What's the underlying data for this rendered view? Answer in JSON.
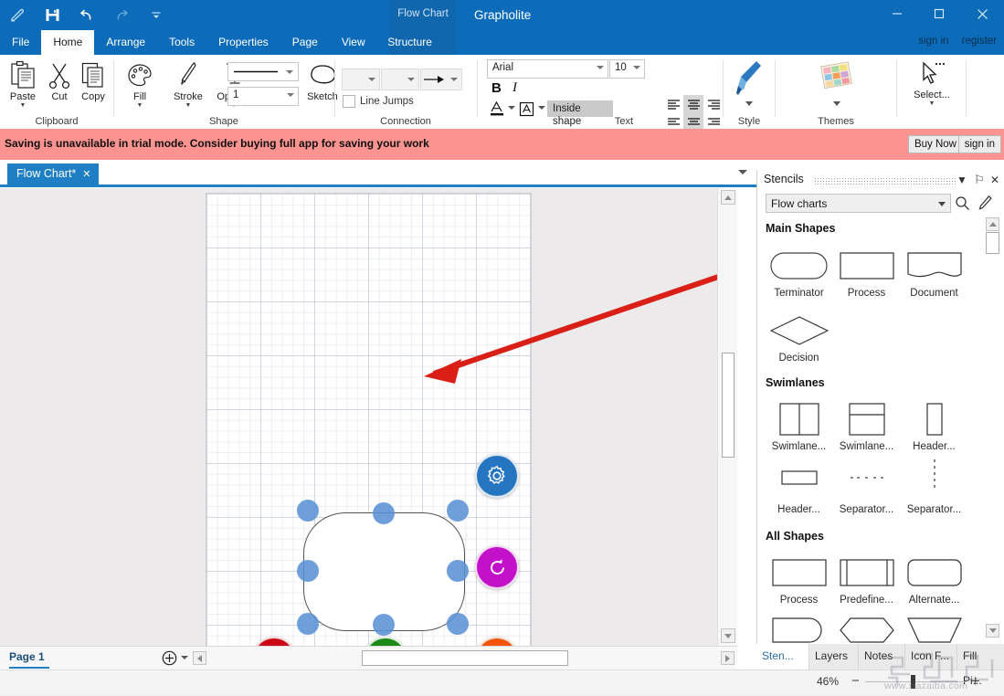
{
  "window": {
    "app_title": "Grapholite",
    "context_tab_label": "Flow Chart",
    "minimize": "–",
    "maximize": "□",
    "close": "✕",
    "sign_in": "sign in",
    "register": "register"
  },
  "quick_access": [
    {
      "name": "pen-icon"
    },
    {
      "name": "save-icon"
    },
    {
      "name": "undo-icon"
    },
    {
      "name": "redo-icon"
    },
    {
      "name": "customize-icon"
    }
  ],
  "ribbon_tabs": [
    {
      "label": "File",
      "active": false
    },
    {
      "label": "Home",
      "active": true
    },
    {
      "label": "Arrange",
      "active": false
    },
    {
      "label": "Tools",
      "active": false
    },
    {
      "label": "Properties",
      "active": false
    },
    {
      "label": "Page",
      "active": false
    },
    {
      "label": "View",
      "active": false
    },
    {
      "label": "Structure",
      "active": false
    }
  ],
  "ribbon": {
    "clipboard": {
      "group_label": "Clipboard",
      "paste": "Paste",
      "cut": "Cut",
      "copy": "Copy"
    },
    "shape": {
      "group_label": "Shape",
      "fill": "Fill",
      "stroke": "Stroke",
      "opacity": "Opacity",
      "line_width_value": "1",
      "sketch": "Sketch"
    },
    "connection": {
      "group_label": "Connection",
      "line_jumps": "Line Jumps"
    },
    "text": {
      "group_label": "Text",
      "font_family": "Arial",
      "font_size": "10",
      "bold": "B",
      "italic": "I",
      "text_position": "Inside shape"
    },
    "style": {
      "group_label": "Style"
    },
    "themes": {
      "group_label": "Themes"
    },
    "select": {
      "label": "Select..."
    }
  },
  "banner": {
    "message": "Saving is unavailable in trial mode. Consider buying full app for saving your work",
    "buy_now": "Buy Now",
    "sign_in": "sign in"
  },
  "document": {
    "tab_label": "Flow Chart*",
    "tab_close": "✕"
  },
  "canvas": {
    "selected_shape": "terminator",
    "actions": [
      {
        "name": "settings-action-button",
        "icon": "gear-icon",
        "color": "#2575c0"
      },
      {
        "name": "rotate-action-button",
        "icon": "rotate-icon",
        "color": "#c310c9"
      },
      {
        "name": "delete-action-button",
        "icon": "close-icon",
        "color": "#cc0a16"
      },
      {
        "name": "swap-action-button",
        "icon": "swap-arrows-icon",
        "color": "#1c8a16"
      },
      {
        "name": "duplicate-action-button",
        "icon": "copy-icon",
        "color": "#f2540a"
      }
    ],
    "annotation_arrow_color": "#d91f16"
  },
  "stencils": {
    "title": "Stencils",
    "collapse": "▼",
    "pin": "⚐",
    "close": "✕",
    "library": "Flow charts",
    "search_icon": "search-icon",
    "edit_icon": "pencil-icon",
    "groups": [
      {
        "title": "Main Shapes",
        "items": [
          {
            "label": "Terminator",
            "shape": "terminator"
          },
          {
            "label": "Process",
            "shape": "rect"
          },
          {
            "label": "Document",
            "shape": "document"
          },
          {
            "label": "Decision",
            "shape": "diamond"
          }
        ]
      },
      {
        "title": "Swimlanes",
        "items": [
          {
            "label": "Swimlane...",
            "shape": "swimlane-v"
          },
          {
            "label": "Swimlane...",
            "shape": "swimlane-h"
          },
          {
            "label": "Header...",
            "shape": "header-v"
          },
          {
            "label": "Header...",
            "shape": "header-h"
          },
          {
            "label": "Separator...",
            "shape": "sep-h"
          },
          {
            "label": "Separator...",
            "shape": "sep-v"
          }
        ]
      },
      {
        "title": "All Shapes",
        "items": [
          {
            "label": "Process",
            "shape": "rect"
          },
          {
            "label": "Predefine...",
            "shape": "predefined"
          },
          {
            "label": "Alternate...",
            "shape": "roundrect"
          },
          {
            "label": "",
            "shape": "dcap"
          },
          {
            "label": "",
            "shape": "hexagon"
          },
          {
            "label": "",
            "shape": "trapezoid"
          }
        ]
      }
    ]
  },
  "bottom": {
    "page_tab": "Page 1",
    "add_page_icon": "plus-circle-icon",
    "panel_tabs": [
      {
        "label": "Sten...",
        "active": true
      },
      {
        "label": "Layers",
        "active": false
      },
      {
        "label": "Notes",
        "active": false
      },
      {
        "label": "Icon F...",
        "active": false
      },
      {
        "label": "Fill Pi...",
        "active": false
      }
    ],
    "zoom_percent": "46%",
    "zoom_out": "−",
    "zoom_in": "+",
    "watermark": "www.xiazaiba.com"
  }
}
